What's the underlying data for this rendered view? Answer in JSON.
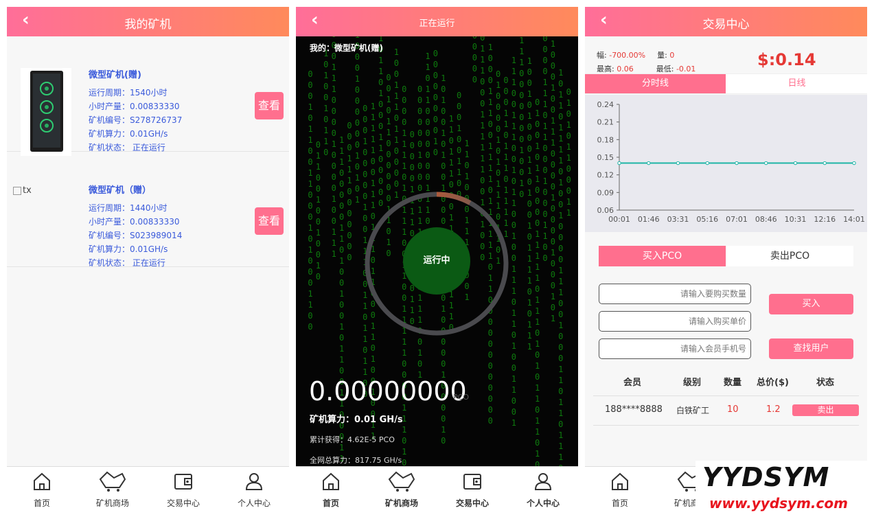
{
  "back_glyph": "‹",
  "panel1": {
    "title": "我的矿机",
    "miners": [
      {
        "name": "微型矿机(赠)",
        "cycle": "运行周期：1540小时",
        "output": "小时产量：0.00833330",
        "serial": "矿机编号：S278726737",
        "power": "矿机算力：0.01GH/s",
        "status": "矿机状态：  正在运行",
        "button": "查看"
      },
      {
        "name": "微型矿机（赠）",
        "cycle": "运行周期：1440小时",
        "output": "小时产量：0.00833330",
        "serial": "矿机编号：S023989014",
        "power": "矿机算力：0.01GH/s",
        "status": "矿机状态：  正在运行",
        "button": "查看"
      }
    ],
    "broken_image_alt": "tx"
  },
  "panel2": {
    "title": "正在运行",
    "my_label": "我的：微型矿机(赠)",
    "status": "运行中",
    "amount": "0.00000000",
    "unit": "PCO",
    "hash_power": "矿机算力：0.01 GH/s",
    "accumulated": "累计获得：4.62E-5 PCO",
    "network_power": "全网总算力：817.75 GH/s",
    "gauge_progress": 0.08
  },
  "panel3": {
    "title": "交易中心",
    "quote": {
      "amp_label": "幅:",
      "amp_value": "-700.00%",
      "vol_label": "量:",
      "vol_value": "0",
      "high_label": "最高:",
      "high_value": "0.06",
      "low_label": "最低:",
      "low_value": "-0.01",
      "price": "$:0.14"
    },
    "tabs": [
      "分时线",
      "日线"
    ],
    "buy_tab": "买入PCO",
    "sell_tab": "卖出PCO",
    "placeholders": {
      "qty": "请输入要购买数量",
      "price": "请输入购买单价",
      "phone": "请输入会员手机号"
    },
    "buy_button": "买入",
    "find_button": "查找用户",
    "table_headers": [
      "会员",
      "级别",
      "数量",
      "总价($)",
      "状态"
    ],
    "row": {
      "member": "188****8888",
      "level": "白铁矿工",
      "qty": "10",
      "total": "1.2",
      "action": "卖出"
    }
  },
  "tabbar": [
    "首页",
    "矿机商场",
    "交易中心",
    "个人中心"
  ],
  "watermark": {
    "logo": "YYDSYM",
    "url": "www.yydsym.com"
  },
  "colors": {
    "brand_pink": "#ff6f8e",
    "header_start": "#ff6e99",
    "header_end": "#ff8a5b",
    "line": "#1db5a6",
    "label_blue": "#3b5bdb",
    "matrix_green": "#0e7a0e"
  },
  "chart_data": {
    "type": "line",
    "x": [
      "00:01",
      "01:46",
      "03:31",
      "05:16",
      "07:01",
      "08:46",
      "10:31",
      "12:16",
      "14:01"
    ],
    "values": [
      0.14,
      0.14,
      0.14,
      0.14,
      0.14,
      0.14,
      0.14,
      0.14,
      0.14
    ],
    "yticks": [
      "0.24",
      "0.21",
      "0.18",
      "0.15",
      "0.12",
      "0.09",
      "0.06"
    ],
    "ylim": [
      0.06,
      0.24
    ]
  }
}
